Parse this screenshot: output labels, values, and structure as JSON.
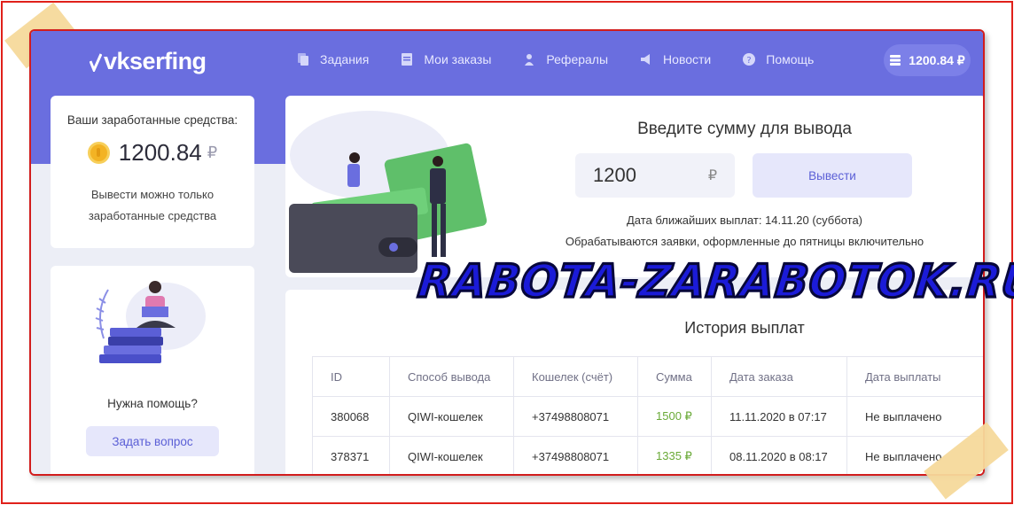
{
  "header": {
    "logo": "vkserfing",
    "nav": [
      {
        "label": "Задания"
      },
      {
        "label": "Мои заказы"
      },
      {
        "label": "Рефералы"
      },
      {
        "label": "Новости"
      },
      {
        "label": "Помощь"
      }
    ],
    "balance": "1200.84 ₽"
  },
  "earnings": {
    "title": "Ваши заработанные средства:",
    "amount": "1200.84",
    "currency": "₽",
    "note_line1": "Вывести можно только",
    "note_line2": "заработанные средства"
  },
  "help": {
    "text": "Нужна помощь?",
    "button": "Задать вопрос"
  },
  "withdraw": {
    "title": "Введите сумму для вывода",
    "amount_value": "1200",
    "currency": "₽",
    "button": "Вывести",
    "next_payout": "Дата ближайших выплат: 14.11.20 (суббота)",
    "note": "Обрабатываются заявки, оформленные до пятницы включительно"
  },
  "history": {
    "title": "История выплат",
    "columns": [
      "ID",
      "Способ вывода",
      "Кошелек (счёт)",
      "Сумма",
      "Дата заказа",
      "Дата выплаты"
    ],
    "rows": [
      [
        "380068",
        "QIWI-кошелек",
        "+37498808071",
        "1500 ₽",
        "11.11.2020 в 07:17",
        "Не выплачено"
      ],
      [
        "378371",
        "QIWI-кошелек",
        "+37498808071",
        "1335 ₽",
        "08.11.2020 в 08:17",
        "Не выплачено"
      ]
    ]
  },
  "watermark": "RABOTA-ZARABOTOK.RU",
  "colors": {
    "header": "#6a6edf",
    "accent": "#5b5fd6",
    "frame_border": "#d21d1d",
    "sum_green": "#6aaa38"
  }
}
